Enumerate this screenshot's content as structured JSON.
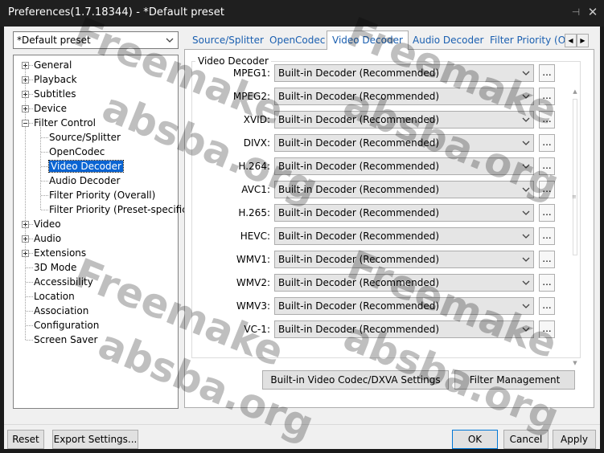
{
  "window": {
    "title": "Preferences(1.7.18344) - *Default preset",
    "pin_glyph": "⊣",
    "close_glyph": "✕"
  },
  "preset": {
    "selected": "*Default preset"
  },
  "tree": {
    "items": [
      {
        "label": "General",
        "expandable": true
      },
      {
        "label": "Playback",
        "expandable": true
      },
      {
        "label": "Subtitles",
        "expandable": true
      },
      {
        "label": "Device",
        "expandable": true
      },
      {
        "label": "Filter Control",
        "expandable": true,
        "expanded": true
      },
      {
        "label": "Source/Splitter"
      },
      {
        "label": "OpenCodec"
      },
      {
        "label": "Video Decoder",
        "selected": true
      },
      {
        "label": "Audio Decoder"
      },
      {
        "label": "Filter Priority (Overall)"
      },
      {
        "label": "Filter Priority (Preset-specific)"
      },
      {
        "label": "Video",
        "expandable": true
      },
      {
        "label": "Audio",
        "expandable": true
      },
      {
        "label": "Extensions",
        "expandable": true
      },
      {
        "label": "3D Mode"
      },
      {
        "label": "Accessibility"
      },
      {
        "label": "Location"
      },
      {
        "label": "Association"
      },
      {
        "label": "Configuration"
      },
      {
        "label": "Screen Saver"
      }
    ]
  },
  "tabs": [
    {
      "label": "Source/Splitter"
    },
    {
      "label": "OpenCodec"
    },
    {
      "label": "Video Decoder",
      "active": true
    },
    {
      "label": "Audio Decoder"
    },
    {
      "label": "Filter Priority (Ov"
    }
  ],
  "tab_scroll": {
    "left": "◀",
    "right": "▶"
  },
  "group": {
    "title": "Video Decoder",
    "rows": [
      {
        "label": "MPEG1:",
        "value": "Built-in Decoder (Recommended)"
      },
      {
        "label": "MPEG2:",
        "value": "Built-in Decoder (Recommended)"
      },
      {
        "label": "XVID:",
        "value": "Built-in Decoder (Recommended)"
      },
      {
        "label": "DIVX:",
        "value": "Built-in Decoder (Recommended)"
      },
      {
        "label": "H.264:",
        "value": "Built-in Decoder (Recommended)"
      },
      {
        "label": "AVC1:",
        "value": "Built-in Decoder (Recommended)"
      },
      {
        "label": "H.265:",
        "value": "Built-in Decoder (Recommended)"
      },
      {
        "label": "HEVC:",
        "value": "Built-in Decoder (Recommended)"
      },
      {
        "label": "WMV1:",
        "value": "Built-in Decoder (Recommended)"
      },
      {
        "label": "WMV2:",
        "value": "Built-in Decoder (Recommended)"
      },
      {
        "label": "WMV3:",
        "value": "Built-in Decoder (Recommended)"
      },
      {
        "label": "VC-1:",
        "value": "Built-in Decoder (Recommended)"
      }
    ],
    "more_label": "..."
  },
  "panel_buttons": {
    "codec_settings": "Built-in Video Codec/DXVA Settings",
    "filter_management": "Filter Management"
  },
  "footer": {
    "reset": "Reset",
    "export": "Export Settings...",
    "ok": "OK",
    "cancel": "Cancel",
    "apply": "Apply"
  },
  "watermark": {
    "line1": "Freemake",
    "line2": "absba.org"
  }
}
